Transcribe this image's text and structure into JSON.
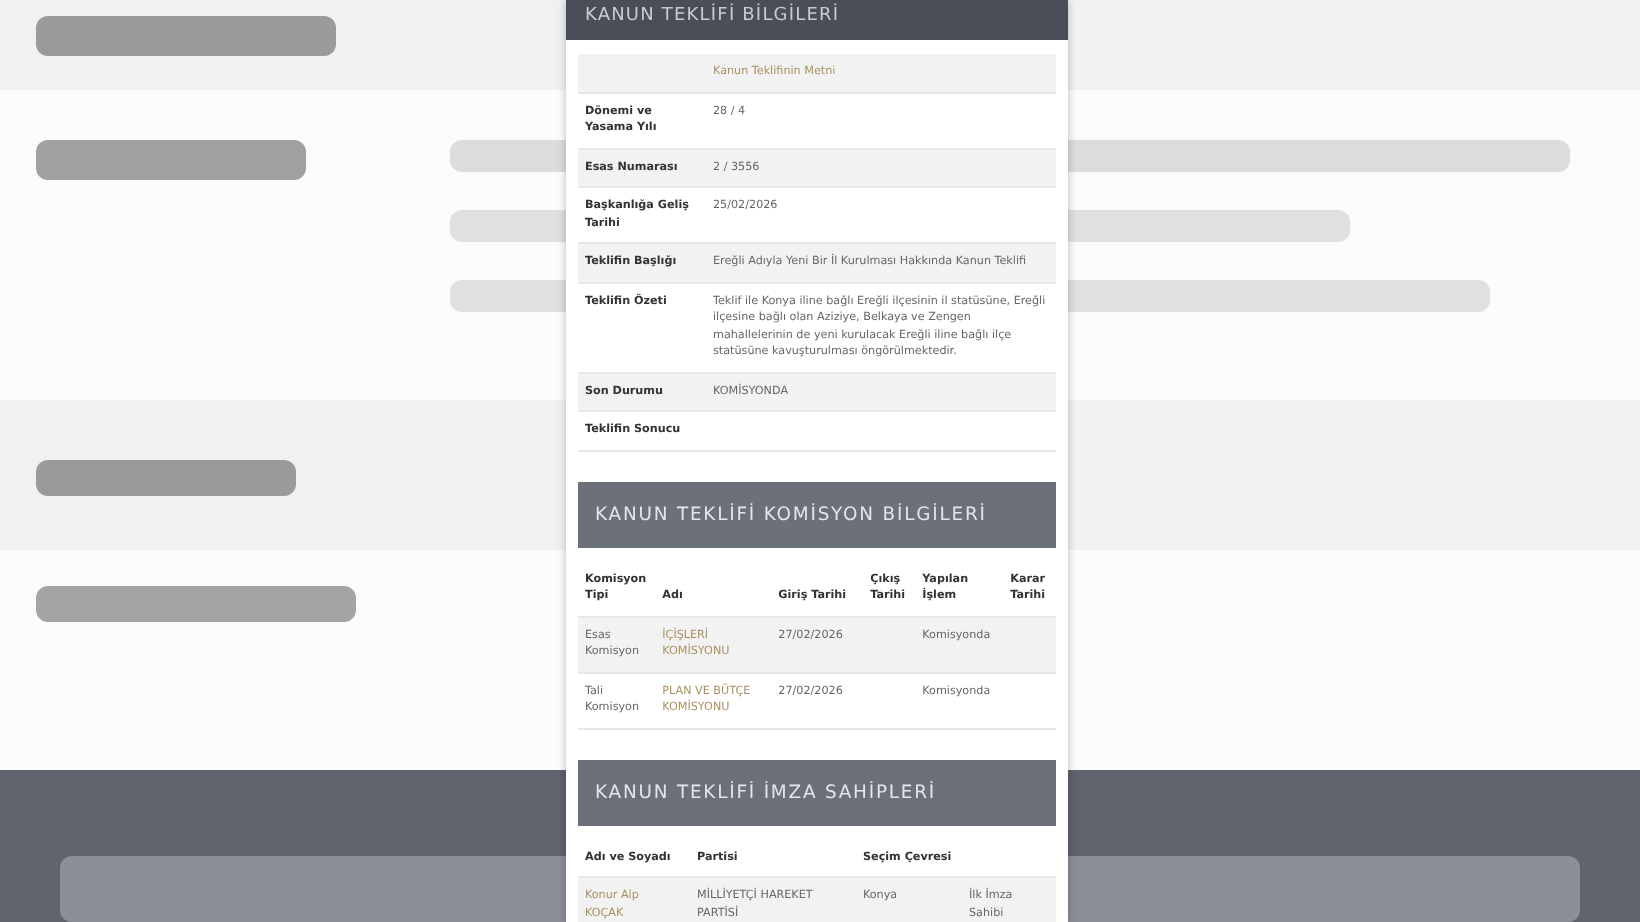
{
  "info": {
    "title": "KANUN TEKLİFİ BİLGİLERİ",
    "link": "Kanun Teklifinin Metni",
    "rows": [
      {
        "label": "Dönemi ve Yasama Yılı",
        "value": "28 / 4"
      },
      {
        "label": "Esas Numarası",
        "value": "2 / 3556"
      },
      {
        "label": "Başkanlığa Geliş Tarihi",
        "value": "25/02/2026"
      },
      {
        "label": "Teklifin Başlığı",
        "value": "Ereğli Adıyla Yeni Bir İl Kurulması Hakkında Kanun Teklifi"
      },
      {
        "label": "Teklifin Özeti",
        "value": "Teklif ile Konya iline bağlı Ereğli ilçesinin il statüsüne, Ereğli ilçesine bağlı olan Aziziye, Belkaya ve Zengen mahallelerinin de yeni kurulacak Ereğli iline bağlı ilçe statüsüne kavuşturulması öngörülmektedir."
      },
      {
        "label": "Son Durumu",
        "value": "KOMİSYONDA"
      },
      {
        "label": "Teklifin Sonucu"
      }
    ]
  },
  "commission": {
    "title": "KANUN TEKLİFİ KOMİSYON BİLGİLERİ",
    "columns": [
      "Komisyon Tipi",
      "Adı",
      "Giriş Tarihi",
      "Çıkış Tarihi",
      "Yapılan İşlem",
      "Karar Tarihi"
    ],
    "rows": [
      {
        "cells": [
          "Esas Komisyon",
          "İÇİŞLERİ KOMİSYONU",
          "27/02/2026",
          "",
          "Komisyonda",
          ""
        ]
      },
      {
        "cells": [
          "Tali Komisyon",
          "PLAN VE BÜTÇE KOMİSYONU",
          "27/02/2026",
          "",
          "Komisyonda",
          ""
        ]
      }
    ]
  },
  "signers": {
    "title": "KANUN TEKLİFİ İMZA SAHİPLERİ",
    "columns": [
      "Adı ve Soyadı",
      "Partisi",
      "Seçim Çevresi",
      ""
    ],
    "rows": [
      {
        "cells": [
          "Konur Alp KOÇAK",
          "MİLLİYETÇİ HAREKET PARTİSİ",
          "Konya",
          "İlk İmza Sahibi"
        ]
      }
    ]
  }
}
